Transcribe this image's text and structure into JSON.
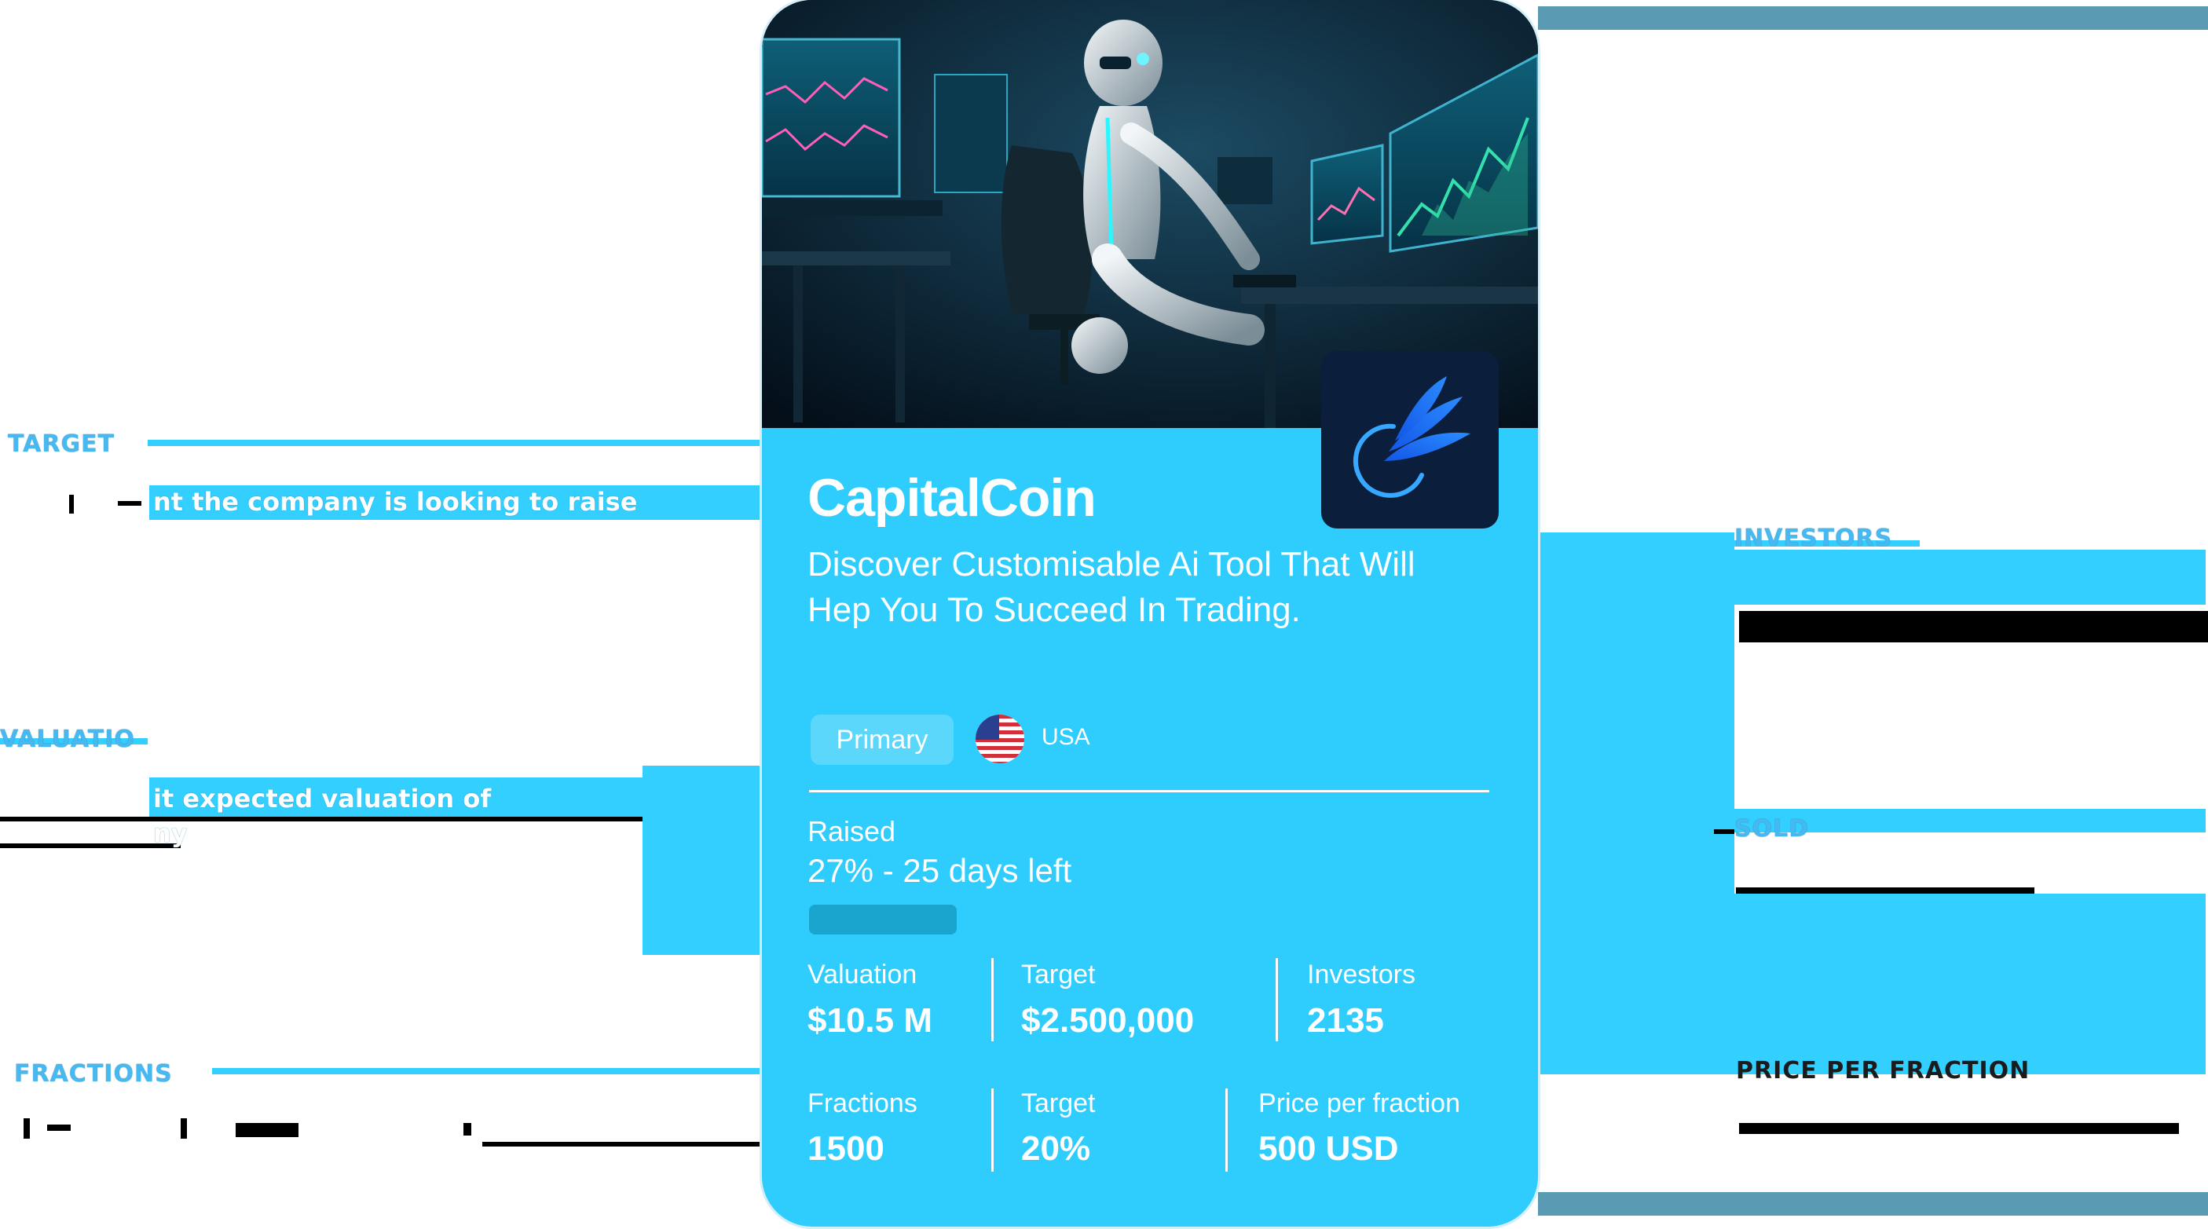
{
  "annotations": {
    "target": {
      "label": "TARGET",
      "description": "nt the company is looking to raise"
    },
    "valuation": {
      "label": "VALUATIO",
      "description_line1": "it expected valuation of",
      "description_line2": "ny"
    },
    "fractions": {
      "label": "FRACTIONS",
      "description": ""
    },
    "investors": {
      "label": "INVESTORS",
      "description": ""
    },
    "sold": {
      "label": "SOLD",
      "description": ""
    },
    "price_per_fraction": {
      "label": "PRICE PER FRACTION",
      "description": ""
    }
  },
  "card": {
    "brand": "CapitalCoin",
    "tagline": "Discover Customisable Ai Tool That Will Hep You To Succeed In Trading.",
    "chip": "Primary",
    "country": "USA",
    "raised": {
      "label": "Raised",
      "value": "27% - 25 days left",
      "percent": 27
    },
    "row1": [
      {
        "label": "Valuation",
        "value": "$10.5 M"
      },
      {
        "label": "Target",
        "value": "$2.500,000"
      },
      {
        "label": "Investors",
        "value": "2135"
      }
    ],
    "row2": [
      {
        "label": "Fractions",
        "value": "1500"
      },
      {
        "label": "Target",
        "value": "20%"
      },
      {
        "label": "Price per fraction",
        "value": "500 USD"
      }
    ]
  },
  "colors": {
    "accent": "#2ecdfe",
    "label": "#47b9f0",
    "tile": "#0b1f3d",
    "hero_bg": "#071a2c"
  },
  "icons": {
    "logo": "capitalcoin-logo-icon",
    "flag": "us-flag-icon"
  }
}
